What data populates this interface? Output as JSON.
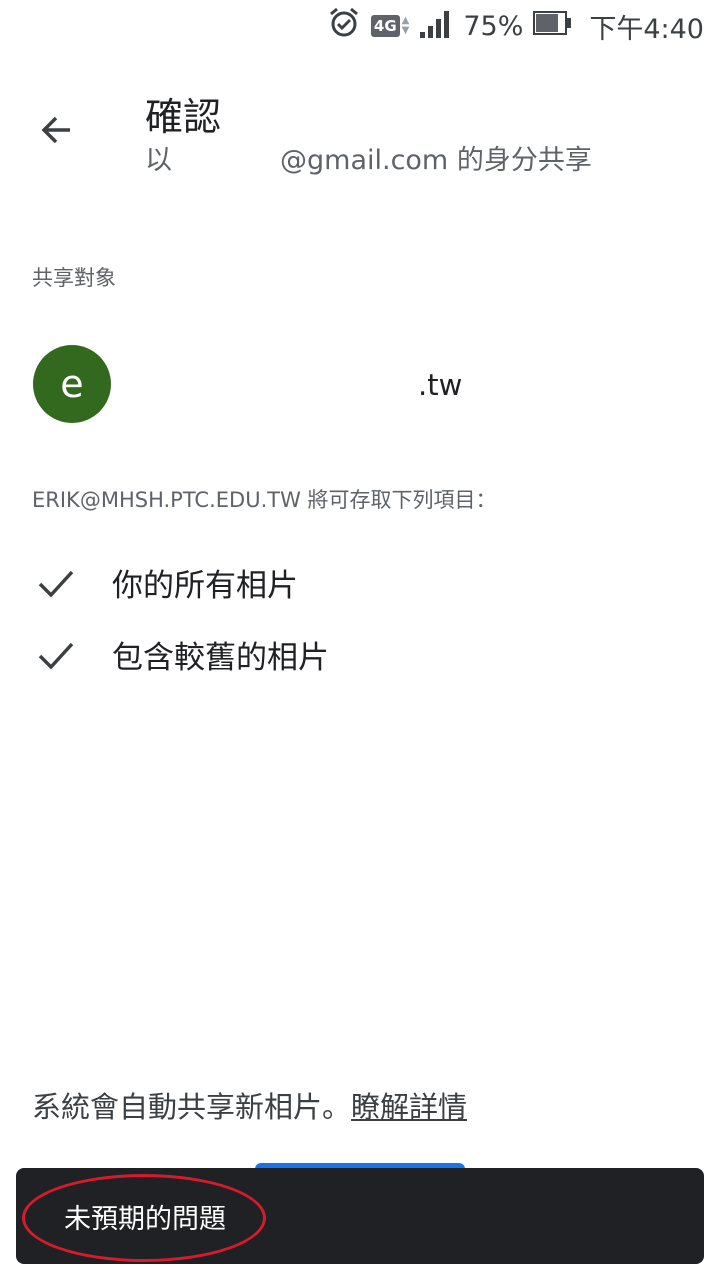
{
  "status_bar": {
    "network": "4G",
    "battery_percent": "75%",
    "time": "下午4:40",
    "icons": [
      "alarm-icon",
      "network-4g-icon",
      "signal-icon",
      "battery-icon"
    ]
  },
  "header": {
    "title": "確認",
    "subtitle_prefix": "以",
    "subtitle_suffix": "@gmail.com 的身分共享"
  },
  "share": {
    "section_label": "共享對象",
    "avatar_letter": "e",
    "recipient_suffix": ".tw",
    "access_text": "ERIK@MHSH.PTC.EDU.TW 將可存取下列項目：",
    "items": [
      {
        "label": "你的所有相片"
      },
      {
        "label": "包含較舊的相片"
      }
    ]
  },
  "footer": {
    "note": "系統會自動共享新相片。",
    "link": "瞭解詳情"
  },
  "snackbar": {
    "message": "未預期的問題"
  },
  "colors": {
    "avatar": "#33691e",
    "snackbar_bg": "#202124",
    "annotation_ring": "#d81b2b",
    "primary_button": "#1a73e8"
  }
}
